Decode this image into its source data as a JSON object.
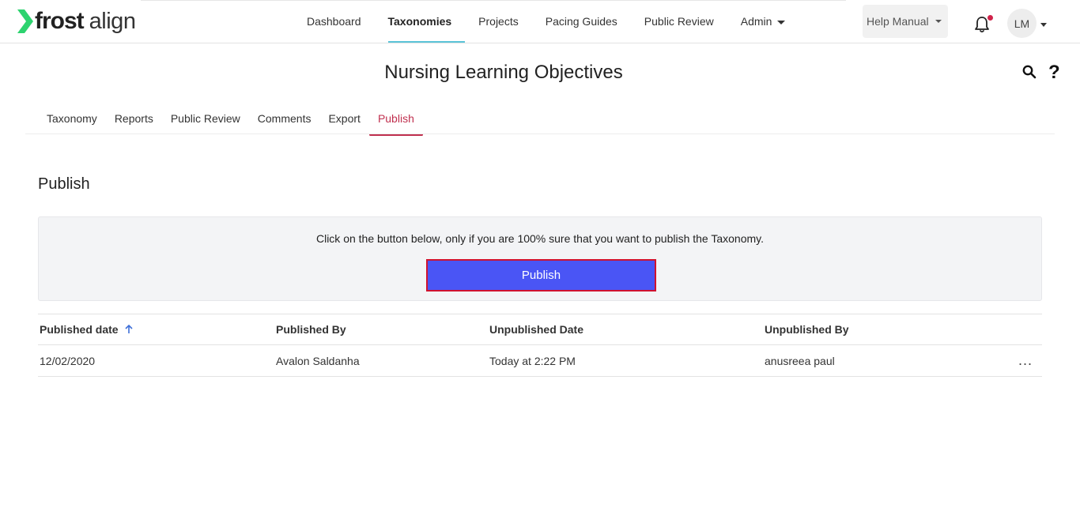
{
  "brand": {
    "name_bold": "frost",
    "name_light": "align",
    "accent": "#2dd36f"
  },
  "nav": {
    "items": [
      {
        "label": "Dashboard"
      },
      {
        "label": "Taxonomies"
      },
      {
        "label": "Projects"
      },
      {
        "label": "Pacing Guides"
      },
      {
        "label": "Public Review"
      },
      {
        "label": "Admin"
      }
    ],
    "active": "Taxonomies",
    "help_label": "Help Manual",
    "notification_icon": "bell-icon",
    "avatar_initials": "LM"
  },
  "page": {
    "title": "Nursing Learning Objectives",
    "search_icon": "search-icon",
    "help_glyph": "?"
  },
  "subtabs": {
    "items": [
      {
        "label": "Taxonomy"
      },
      {
        "label": "Reports"
      },
      {
        "label": "Public Review"
      },
      {
        "label": "Comments"
      },
      {
        "label": "Export"
      },
      {
        "label": "Publish"
      }
    ],
    "active": "Publish",
    "active_color": "#c0304f"
  },
  "publish_section": {
    "title": "Publish",
    "message": "Click on the button below, only if you are 100% sure that you want to publish the Taxonomy.",
    "button_label": "Publish",
    "button_color": "#4a55f5"
  },
  "table": {
    "headers": {
      "published_date": "Published date",
      "published_by": "Published By",
      "unpublished_date": "Unpublished Date",
      "unpublished_by": "Unpublished By"
    },
    "sort_icon": "arrow-up-icon",
    "rows": [
      {
        "published_date": "12/02/2020",
        "published_by": "Avalon Saldanha",
        "unpublished_date": "Today at 2:22 PM",
        "unpublished_by": "anusreea paul",
        "actions": "..."
      }
    ]
  }
}
